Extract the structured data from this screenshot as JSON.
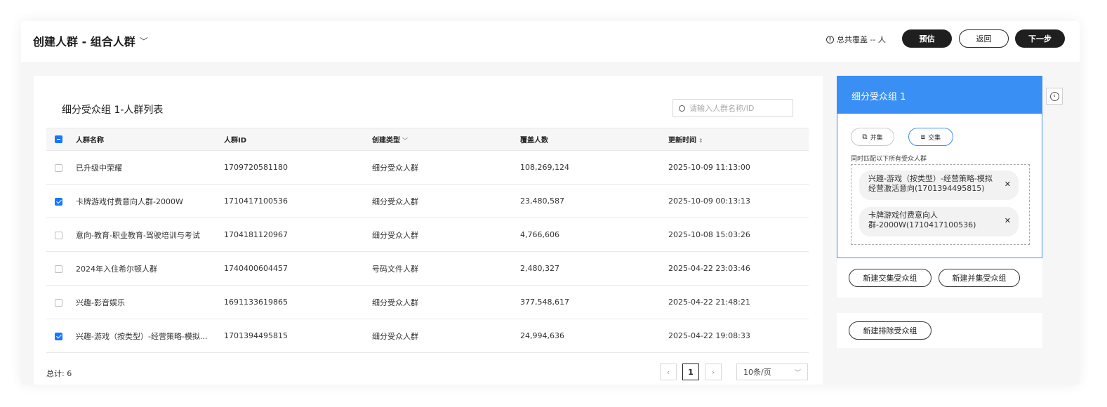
{
  "header": {
    "title": "创建人群 - 组合人群",
    "coverage_text": "总共覆盖 -- 人",
    "estimate_label": "预估",
    "back_label": "返回",
    "next_label": "下一步"
  },
  "list": {
    "title": "细分受众组 1-人群列表",
    "search_placeholder": "请输入人群名称/ID",
    "columns": [
      "人群名称",
      "人群ID",
      "创建类型",
      "覆盖人数",
      "更新时间"
    ],
    "rows": [
      {
        "checked": false,
        "name": "已升级中荣耀",
        "id": "1709720581180",
        "type": "细分受众人群",
        "count": "108,269,124",
        "time": "2025-10-09 11:13:00"
      },
      {
        "checked": true,
        "name": "卡牌游戏付费意向人群-2000W",
        "id": "1710417100536",
        "type": "细分受众人群",
        "count": "23,480,587",
        "time": "2025-10-09 00:13:13"
      },
      {
        "checked": false,
        "name": "意向-教育-职业教育-驾驶培训与考试",
        "id": "1704181120967",
        "type": "细分受众人群",
        "count": "4,766,606",
        "time": "2025-10-08 15:03:26"
      },
      {
        "checked": false,
        "name": "2024年入住希尔顿人群",
        "id": "1740400604457",
        "type": "号码文件人群",
        "count": "2,480,327",
        "time": "2025-04-22 23:03:46"
      },
      {
        "checked": false,
        "name": "兴趣-影音娱乐",
        "id": "1691133619865",
        "type": "细分受众人群",
        "count": "377,548,617",
        "time": "2025-04-22 21:48:21"
      },
      {
        "checked": true,
        "name": "兴趣-游戏（按类型）-经营策略-模拟...",
        "id": "1701394495815",
        "type": "细分受众人群",
        "count": "24,994,636",
        "time": "2025-04-22 19:08:33"
      }
    ],
    "total_label": "总计: 6",
    "current_page": "1",
    "prev_icon": "‹",
    "next_icon": "›",
    "page_size": "10条/页"
  },
  "group_panel": {
    "title": "细分受众组 1",
    "union_label": "并集",
    "intersect_label": "交集",
    "match_label": "同时匹配以下所有受众人群",
    "selected": [
      "兴趣-游戏（按类型）-经营策略-模拟经营激活意向(1701394495815)",
      "卡牌游戏付费意向人群-2000W(1710417100536)"
    ],
    "new_intersect_label": "新建交集受众组",
    "new_union_label": "新建并集受众组",
    "new_exclude_label": "新建排除受众组"
  },
  "colors": {
    "accent": "#3a8ff5",
    "checkbox": "#1677ff",
    "dark_button": "#1f1f1f"
  }
}
